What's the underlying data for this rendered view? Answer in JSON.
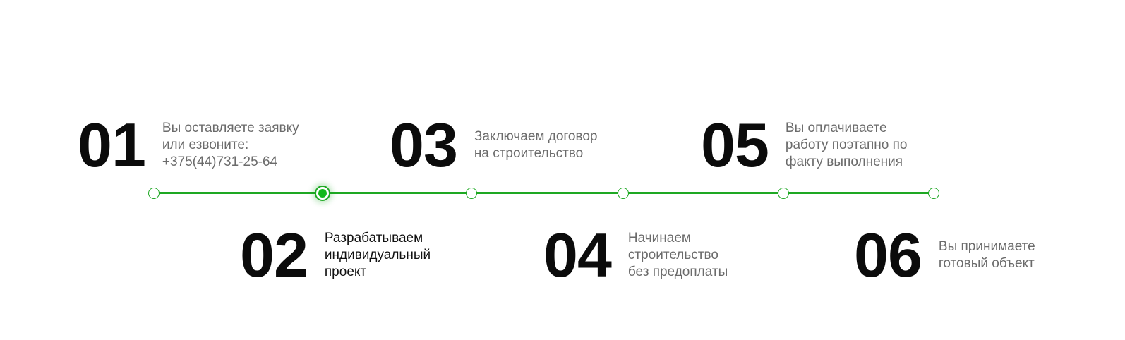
{
  "timeline": {
    "accent_color": "#1ea823",
    "active_step": 2,
    "steps": [
      {
        "number": "01",
        "text": "Вы оставляете заявку\nили езвоните:\n+375(44)731-25-64"
      },
      {
        "number": "02",
        "text": "Разрабатываем\nиндивидуальный\nпроект"
      },
      {
        "number": "03",
        "text": "Заключаем договор\nна строительство"
      },
      {
        "number": "04",
        "text": "Начинаем\nстроительство\nбез предоплаты"
      },
      {
        "number": "05",
        "text": "Вы оплачиваете\nработу поэтапно по\nфакту выполнения"
      },
      {
        "number": "06",
        "text": "Вы принимаете\nготовый объект"
      }
    ]
  }
}
